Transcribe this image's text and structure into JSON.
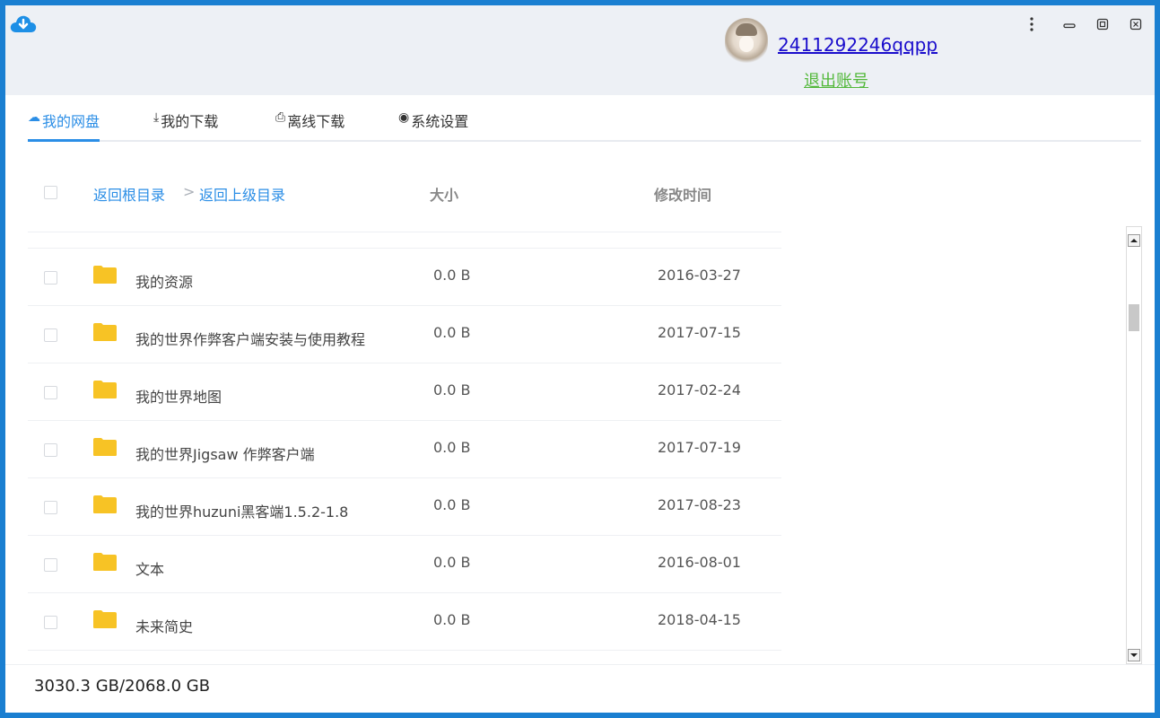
{
  "header": {
    "app_icon": "cloud-download-icon",
    "username": "2411292246qqpp",
    "logout_label": "退出账号",
    "window_controls": [
      "more-vert-icon",
      "minimize-icon",
      "maximize-icon",
      "close-icon"
    ]
  },
  "tabs": [
    {
      "label": "我的网盘",
      "icon": "cloud-icon",
      "glyph": "☁",
      "active": true
    },
    {
      "label": "我的下载",
      "icon": "download-icon",
      "glyph": "⤓",
      "active": false
    },
    {
      "label": "离线下载",
      "icon": "offline-download-icon",
      "glyph": "⎙",
      "active": false
    },
    {
      "label": "系统设置",
      "icon": "settings-icon",
      "glyph": "◉",
      "active": false
    }
  ],
  "breadcrumb": {
    "root_label": "返回根目录",
    "separator": ">",
    "parent_label": "返回上级目录"
  },
  "columns": {
    "size": "大小",
    "modified": "修改时间"
  },
  "files": [
    {
      "name": "我的资源",
      "size": "0.0 B",
      "date": "2016-03-27",
      "type": "folder"
    },
    {
      "name": "我的世界作弊客户端安装与使用教程",
      "size": "0.0 B",
      "date": "2017-07-15",
      "type": "folder"
    },
    {
      "name": "我的世界地图",
      "size": "0.0 B",
      "date": "2017-02-24",
      "type": "folder"
    },
    {
      "name": "我的世界Jigsaw 作弊客户端",
      "size": "0.0 B",
      "date": "2017-07-19",
      "type": "folder"
    },
    {
      "name": "我的世界huzuni黑客端1.5.2-1.8",
      "size": "0.0 B",
      "date": "2017-08-23",
      "type": "folder"
    },
    {
      "name": "文本",
      "size": "0.0 B",
      "date": "2016-08-01",
      "type": "folder"
    },
    {
      "name": "未来简史",
      "size": "0.0 B",
      "date": "2018-04-15",
      "type": "folder"
    }
  ],
  "footer": {
    "storage": "3030.3 GB/2068.0 GB"
  },
  "colors": {
    "accent": "#2b8ee6",
    "folder": "#f7c325",
    "logout": "#52b83a",
    "username": "#1a0dcc",
    "frame": "#1a7fd1"
  }
}
